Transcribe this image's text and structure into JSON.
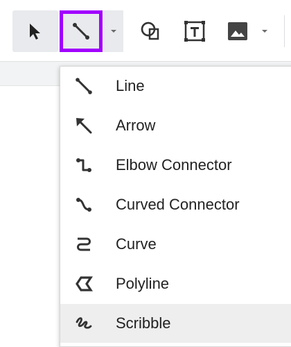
{
  "toolbar": {
    "tools": [
      {
        "name": "select-tool",
        "icon": "cursor-arrow-icon"
      },
      {
        "name": "line-tool",
        "icon": "line-icon",
        "active": true
      },
      {
        "name": "shape-tool",
        "icon": "shape-icon"
      },
      {
        "name": "textbox-tool",
        "icon": "textbox-icon"
      },
      {
        "name": "image-tool",
        "icon": "image-icon"
      }
    ],
    "active_color": "#a100ff"
  },
  "line_menu": {
    "items": [
      {
        "label": "Line",
        "icon": "line-icon"
      },
      {
        "label": "Arrow",
        "icon": "arrow-icon"
      },
      {
        "label": "Elbow Connector",
        "icon": "elbow-connector-icon"
      },
      {
        "label": "Curved Connector",
        "icon": "curved-connector-icon"
      },
      {
        "label": "Curve",
        "icon": "curve-icon"
      },
      {
        "label": "Polyline",
        "icon": "polyline-icon"
      },
      {
        "label": "Scribble",
        "icon": "scribble-icon",
        "highlighted": true
      }
    ]
  }
}
